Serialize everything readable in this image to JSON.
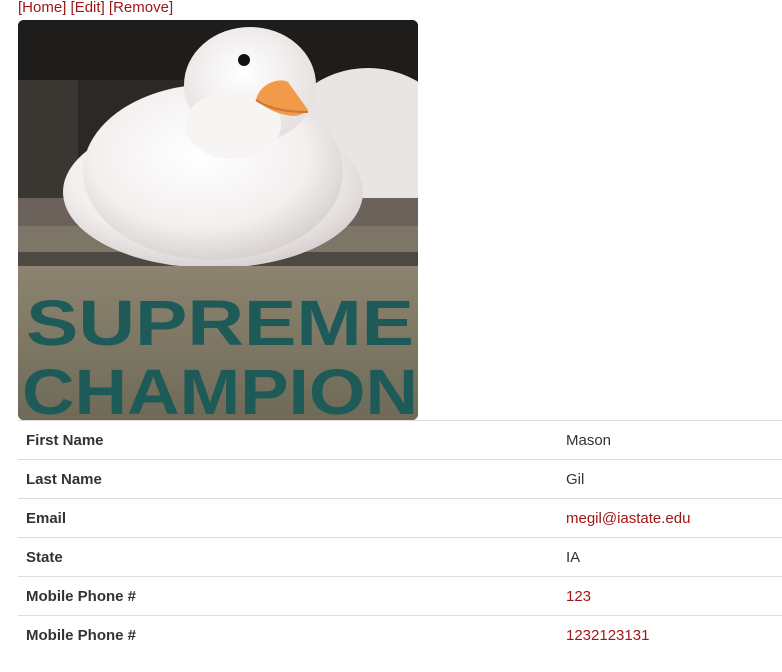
{
  "nav": {
    "links": [
      {
        "label": "Home"
      },
      {
        "label": "Edit"
      },
      {
        "label": "Remove"
      }
    ]
  },
  "photo": {
    "sign_line1": "SUPREME",
    "sign_line2": "CHAMPION"
  },
  "details": {
    "rows": [
      {
        "label": "First Name",
        "value": "Mason"
      },
      {
        "label": "Last Name",
        "value": "Gil"
      },
      {
        "label": "Email",
        "value": "megil@iastate.edu"
      },
      {
        "label": "State",
        "value": "IA"
      },
      {
        "label": "Mobile Phone #",
        "value": "123"
      },
      {
        "label": "Mobile Phone #",
        "value": "1232123131"
      }
    ]
  },
  "colors": {
    "link": "#a11616",
    "text": "#333333",
    "row_border": "#dddddd"
  }
}
